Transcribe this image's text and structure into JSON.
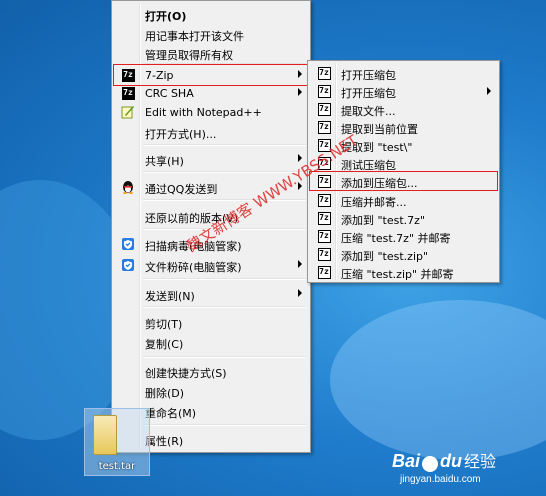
{
  "main_menu": {
    "items": [
      {
        "label": "打开(O)",
        "icon": "none",
        "bold": true
      },
      {
        "label": "用记事本打开该文件",
        "icon": "none"
      },
      {
        "label": "管理员取得所有权",
        "icon": "none"
      },
      {
        "label": "7-Zip",
        "icon": "7zip-icon",
        "submenu": true,
        "highlighted": true
      },
      {
        "label": "CRC SHA",
        "icon": "7zip-icon",
        "submenu": true
      },
      {
        "label": "Edit with Notepad++",
        "icon": "notepad-plus-icon"
      },
      {
        "label": "打开方式(H)...",
        "icon": "none"
      },
      {
        "label": "共享(H)",
        "icon": "none",
        "submenu": true
      },
      {
        "label": "通过QQ发送到",
        "icon": "qq-penguin-icon",
        "submenu": true
      },
      {
        "label": "还原以前的版本(V)",
        "icon": "none"
      },
      {
        "label": "扫描病毒(电脑管家)",
        "icon": "shield-icon"
      },
      {
        "label": "文件粉碎(电脑管家)",
        "icon": "shield-icon",
        "submenu": true
      },
      {
        "label": "发送到(N)",
        "icon": "none",
        "submenu": true
      },
      {
        "label": "剪切(T)",
        "icon": "none"
      },
      {
        "label": "复制(C)",
        "icon": "none"
      },
      {
        "label": "创建快捷方式(S)",
        "icon": "none"
      },
      {
        "label": "删除(D)",
        "icon": "none"
      },
      {
        "label": "重命名(M)",
        "icon": "none"
      },
      {
        "label": "属性(R)",
        "icon": "none"
      }
    ]
  },
  "sub_menu": {
    "items": [
      {
        "label": "打开压缩包",
        "icon": "7zip-icon"
      },
      {
        "label": "打开压缩包",
        "icon": "7zip-icon",
        "submenu": true
      },
      {
        "label": "提取文件...",
        "icon": "7zip-icon"
      },
      {
        "label": "提取到当前位置",
        "icon": "7zip-icon"
      },
      {
        "label": "提取到 \"test\\\"",
        "icon": "7zip-icon"
      },
      {
        "label": "测试压缩包",
        "icon": "7zip-icon"
      },
      {
        "label": "添加到压缩包...",
        "icon": "7zip-icon",
        "highlighted": true
      },
      {
        "label": "压缩并邮寄...",
        "icon": "7zip-icon"
      },
      {
        "label": "添加到 \"test.7z\"",
        "icon": "7zip-icon"
      },
      {
        "label": "压缩 \"test.7z\" 并邮寄",
        "icon": "7zip-icon"
      },
      {
        "label": "添加到 \"test.zip\"",
        "icon": "7zip-icon"
      },
      {
        "label": "压缩 \"test.zip\" 并邮寄",
        "icon": "7zip-icon"
      }
    ]
  },
  "desktop_file": {
    "name": "test.tar"
  },
  "watermark": {
    "text": "魏文新博客 WWW.YBSS.NET"
  },
  "brand": {
    "logo": "Bai",
    "logo2": "du",
    "suffix": "经验",
    "url": "jingyan.baidu.com"
  },
  "colors": {
    "highlight_border": "#e02020",
    "menu_bg": "#f0f0f0"
  }
}
